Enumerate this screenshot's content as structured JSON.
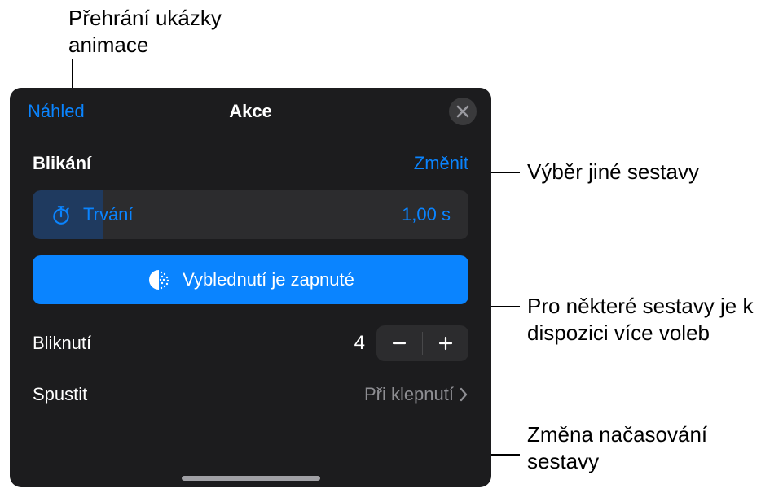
{
  "callouts": {
    "preview": "Přehrání ukázky animace",
    "change": "Výběr jiné sestavy",
    "fade": "Pro některé sestavy je k dispozici více voleb",
    "start": "Změna načasování sestavy"
  },
  "panel": {
    "preview_link": "Náhled",
    "title": "Akce",
    "section_title": "Blikání",
    "change_link": "Změnit",
    "duration_label": "Trvání",
    "duration_value": "1,00 s",
    "fade_label": "Vyblednutí je zapnuté",
    "blink_label": "Bliknutí",
    "blink_value": "4",
    "start_label": "Spustit",
    "start_value": "Při klepnutí"
  }
}
